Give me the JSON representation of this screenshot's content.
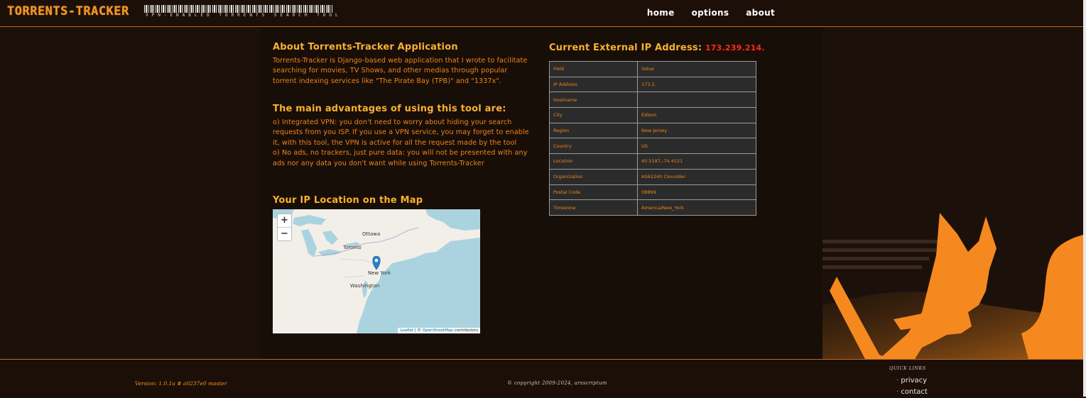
{
  "header": {
    "logo": "TORRENTS-TRACKER",
    "tagline": "VPN-ENABLED TORRENTS SEARCH TOOL",
    "nav": [
      "home",
      "options",
      "about"
    ]
  },
  "about": {
    "title": "About Torrents-Tracker Application",
    "intro": "Torrents-Tracker is Django-based web application that I wrote to facilitate searching for movies, TV Shows, and other medias through popular torrent indexing services like \"The Pirate Bay (TPB)\" and \"1337x\".",
    "advantages_title": "The main advantages of using this tool are:",
    "advantage_1": "o) Integrated VPN: you don't need to worry about hiding your search requests from you ISP. If you use a VPN service, you may forget to enable it, with this tool, the VPN is active for all the request made by the tool",
    "advantage_2": "o) No ads, no trackers, just pure data: you will not be presented with any ads nor any data you don't want while using Torrents-Tracker",
    "map_title": "Your IP Location on the Map"
  },
  "map": {
    "zoom_in": "+",
    "zoom_out": "−",
    "cities": [
      "Ottawa",
      "Toronto",
      "New York",
      "Washington"
    ],
    "attribution_leaflet": "Leaflet",
    "attribution_sep": " | © ",
    "attribution_osm": "OpenStreetMap",
    "attribution_tail": " contributors"
  },
  "ip_info": {
    "heading": "Current External IP Address:",
    "ip": "173.239.214.",
    "columns": [
      "Field",
      "Value"
    ],
    "rows": [
      [
        "IP Address",
        "173.2."
      ],
      [
        "Hostname",
        ""
      ],
      [
        "City",
        "Edison"
      ],
      [
        "Region",
        "New Jersey"
      ],
      [
        "Country",
        "US"
      ],
      [
        "Location",
        "40.5187,-74.4121"
      ],
      [
        "Organization",
        "AS62240 Clouvider"
      ],
      [
        "Postal Code",
        "08899"
      ],
      [
        "Timezone",
        "America/New_York"
      ]
    ]
  },
  "footer": {
    "version": "Version: 1.0.1a # a0237e0 master",
    "copyright": "© copyright 2009-2024, arsscriptum",
    "quick_links_title": "QUICK LINKS",
    "quick_links": [
      "privacy",
      "contact"
    ]
  },
  "colors": {
    "background": "#1c110a",
    "accent_orange": "#f5931f",
    "heading_gold": "#f7b130",
    "ip_red": "#ff2a1a"
  }
}
